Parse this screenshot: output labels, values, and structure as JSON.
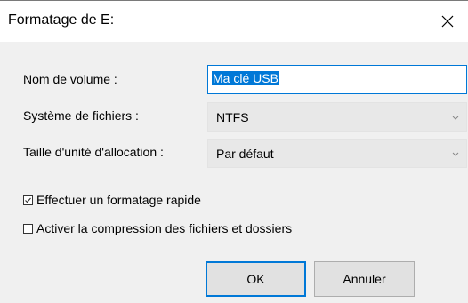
{
  "window": {
    "title": "Formatage de E:"
  },
  "form": {
    "volume_label": "Nom de volume :",
    "volume_value": "Ma clé USB",
    "filesystem_label": "Système de fichiers :",
    "filesystem_value": "NTFS",
    "allocation_label": "Taille d'unité d'allocation :",
    "allocation_value": "Par défaut"
  },
  "options": {
    "quick_format": {
      "label": "Effectuer un formatage rapide",
      "checked": true
    },
    "compression": {
      "label": "Activer la compression des fichiers et dossiers",
      "checked": false
    }
  },
  "buttons": {
    "ok": "OK",
    "cancel": "Annuler"
  },
  "colors": {
    "accent": "#0078d7",
    "background": "#f0f0f0",
    "titlebar": "#ffffff"
  },
  "icons": {
    "close": "close-icon",
    "dropdown": "chevron-down-icon",
    "checkbox": "checkmark-icon"
  }
}
